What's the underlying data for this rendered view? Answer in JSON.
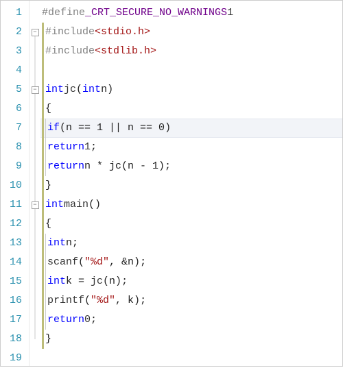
{
  "editor": {
    "highlighted_line": 7,
    "line_count": 19
  },
  "lines": {
    "l1": {
      "directive": "#define",
      "macro": "_CRT_SECURE_NO_WARNINGS",
      "value": "1"
    },
    "l2": {
      "directive": "#include",
      "header": "<stdio.h>"
    },
    "l3": {
      "directive": "#include",
      "header": "<stdlib.h>"
    },
    "l5": {
      "kw": "int",
      "fn": "jc",
      "params_open": "(",
      "param_kw": "int",
      "param_name": "n",
      "params_close": ")"
    },
    "l6": {
      "brace": "{"
    },
    "l7": {
      "kw": "if",
      "open": "(",
      "expr": "n == 1 || n == 0",
      "close": ")"
    },
    "l8": {
      "kw": "return",
      "val": "1",
      "semi": ";"
    },
    "l9": {
      "kw": "return",
      "expr": "n * jc(n - 1)",
      "semi": ";"
    },
    "l10": {
      "brace": "}"
    },
    "l11": {
      "kw": "int",
      "fn": "main",
      "parens": "()"
    },
    "l12": {
      "brace": "{"
    },
    "l13": {
      "kw": "int",
      "name": "n",
      "semi": ";"
    },
    "l14": {
      "fn": "scanf",
      "open": "(",
      "str": "\"%d\"",
      "rest": ", &n)",
      "semi": ";"
    },
    "l15": {
      "kw": "int",
      "lhs": "k = ",
      "fn": "jc",
      "args": "(n)",
      "semi": ";"
    },
    "l16": {
      "fn": "printf",
      "open": "(",
      "str": "\"%d\"",
      "rest": ", k)",
      "semi": ";"
    },
    "l17": {
      "kw": "return",
      "val": "0",
      "semi": ";"
    },
    "l18": {
      "brace": "}"
    }
  },
  "gutter": [
    "1",
    "2",
    "3",
    "4",
    "5",
    "6",
    "7",
    "8",
    "9",
    "10",
    "11",
    "12",
    "13",
    "14",
    "15",
    "16",
    "17",
    "18",
    "19"
  ]
}
